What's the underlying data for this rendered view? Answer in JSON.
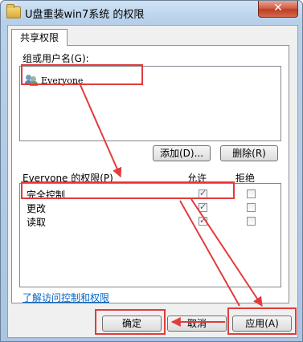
{
  "window": {
    "title": "U盘重装win7系统 的权限",
    "close_glyph": "✕"
  },
  "tab": {
    "label": "共享权限"
  },
  "group": {
    "label": "组或用户名(G):",
    "items": [
      {
        "name": "Everyone",
        "icon": "users-icon"
      }
    ]
  },
  "buttons": {
    "add": "添加(D)...",
    "remove": "删除(R)",
    "ok": "确定",
    "cancel": "取消",
    "apply": "应用(A)"
  },
  "permissions": {
    "header": "Everyone 的权限(P)",
    "allow_header": "允许",
    "deny_header": "拒绝",
    "rows": [
      {
        "name": "完全控制",
        "allow": true,
        "deny": false
      },
      {
        "name": "更改",
        "allow": true,
        "deny": false
      },
      {
        "name": "读取",
        "allow": true,
        "deny": false
      }
    ]
  },
  "link": "了解访问控制和权限",
  "annotation_color": "#e23b3b"
}
